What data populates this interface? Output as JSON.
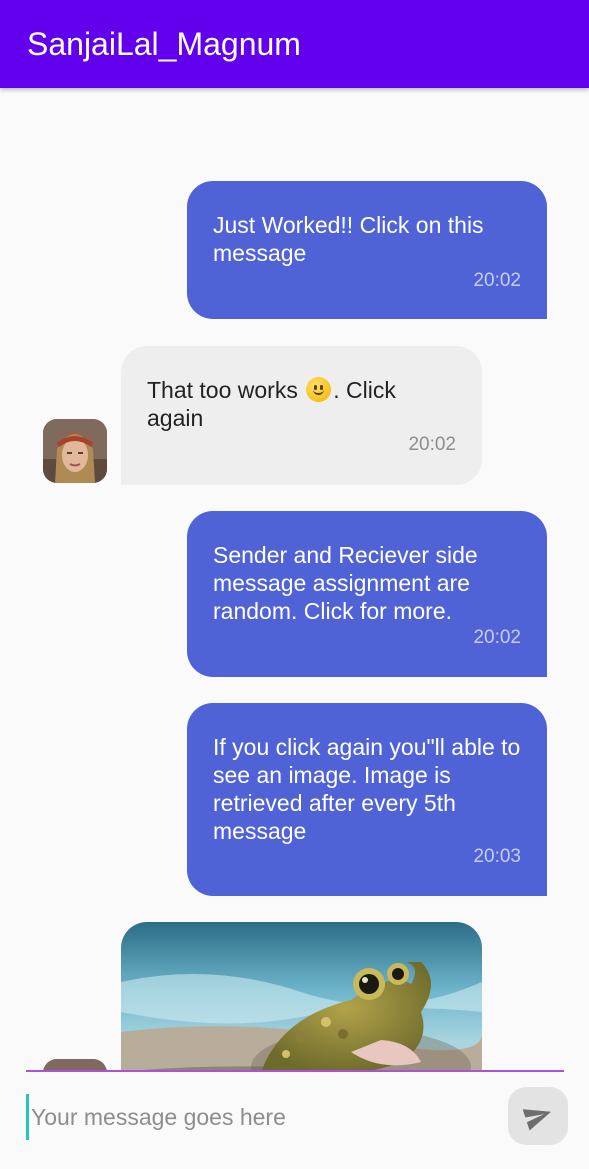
{
  "app_bar": {
    "title": "SanjaiLal_Magnum"
  },
  "messages": [
    {
      "type": "sent",
      "text": "Just Worked!! Click on this message",
      "time": "20:02"
    },
    {
      "type": "received",
      "text_before": "That too works ",
      "emoji": "slightly-smiling-face-emoji",
      "text_after": ". Click again",
      "time": "20:02",
      "avatar": "user-avatar"
    },
    {
      "type": "sent",
      "text": "Sender and Reciever side message assignment are random.  Click for more.",
      "time": "20:02"
    },
    {
      "type": "sent",
      "text": "If you click again you\"ll able to see an image. Image is retrieved after every 5th message",
      "time": "20:03"
    },
    {
      "type": "received-image",
      "image": "frog-photo",
      "avatar": "user-avatar"
    }
  ],
  "composer": {
    "placeholder": "Your message goes here",
    "value": "",
    "send_icon": "send-icon"
  },
  "colors": {
    "app_bar": "#6200ee",
    "sent_bubble": "#4f63d7",
    "received_bubble": "#eeeeee",
    "composer_line": "#b04fd8",
    "cursor": "#26c6b0"
  }
}
